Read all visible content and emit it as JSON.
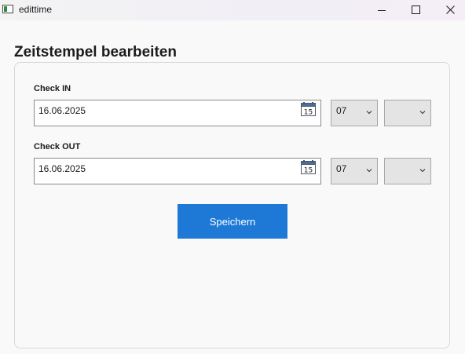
{
  "window": {
    "title": "edittime"
  },
  "page": {
    "title": "Zeitstempel bearbeiten"
  },
  "check_in": {
    "label": "Check IN",
    "date": "16.06.2025",
    "hour": "07",
    "minute": ""
  },
  "check_out": {
    "label": "Check OUT",
    "date": "16.06.2025",
    "hour": "07",
    "minute": ""
  },
  "actions": {
    "save_label": "Speichern"
  },
  "colors": {
    "accent": "#1e79d6"
  },
  "icons": {
    "calendar_day": "15"
  }
}
